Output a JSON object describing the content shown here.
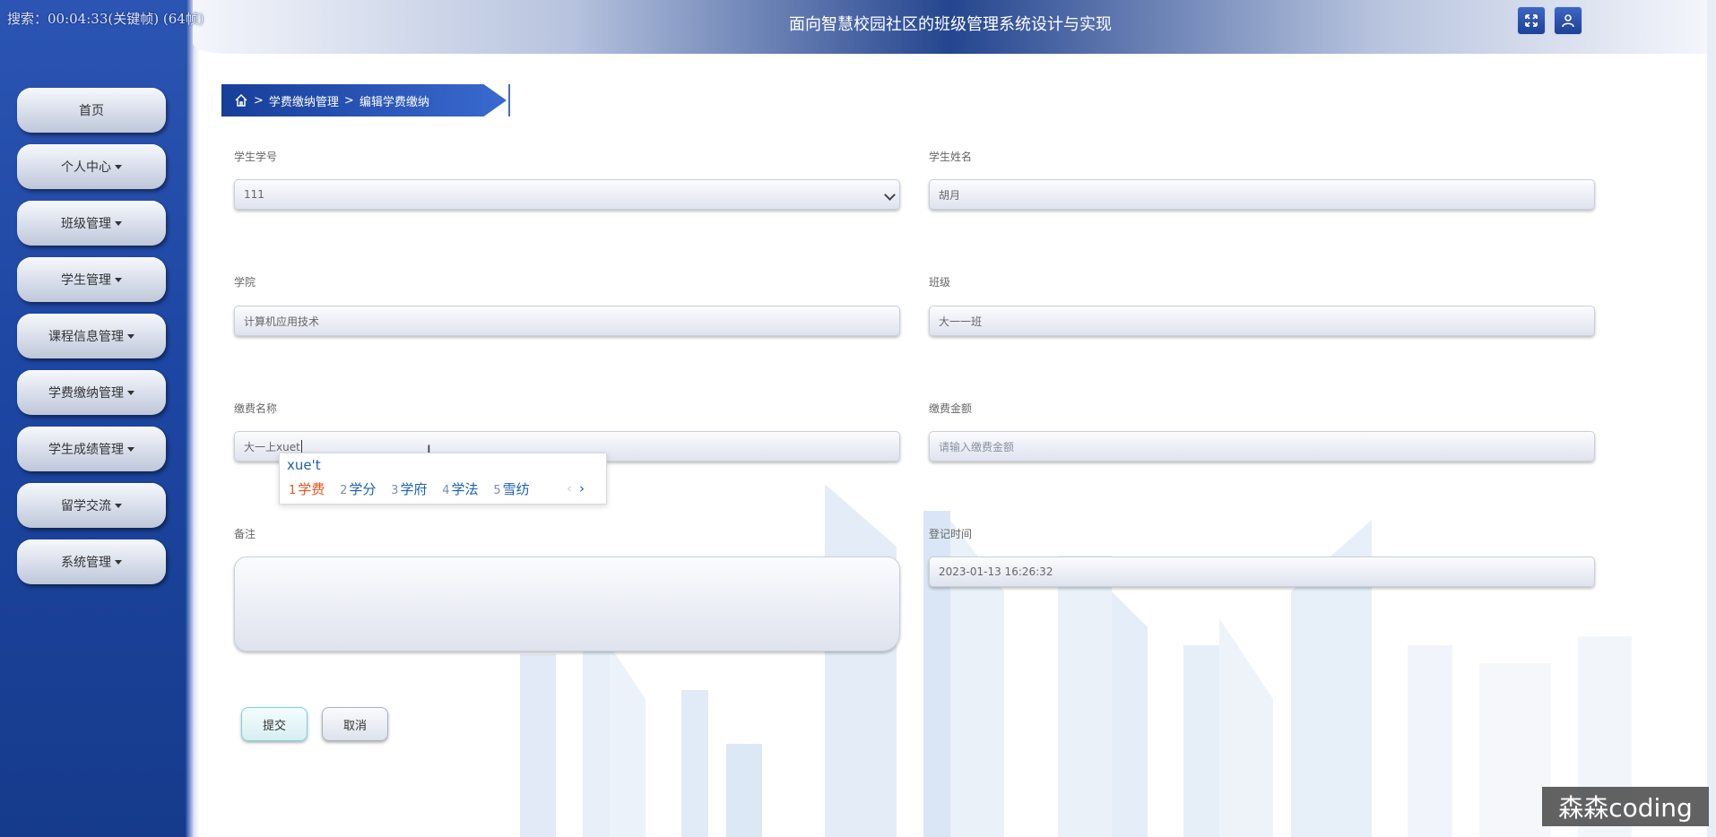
{
  "recorder_overlay": "搜索：00:04:33(关键帧) (64帧)",
  "header": {
    "title": "面向智慧校园社区的班级管理系统设计与实现"
  },
  "sidebar": {
    "items": [
      {
        "label": "首页"
      },
      {
        "label": "个人中心"
      },
      {
        "label": "班级管理"
      },
      {
        "label": "学生管理"
      },
      {
        "label": "课程信息管理"
      },
      {
        "label": "学费缴纳管理"
      },
      {
        "label": "学生成绩管理"
      },
      {
        "label": "留学交流"
      },
      {
        "label": "系统管理"
      }
    ]
  },
  "breadcrumb": {
    "sep": ">",
    "level1": "学费缴纳管理",
    "level2": "编辑学费缴纳"
  },
  "form": {
    "student_id": {
      "label": "学生学号",
      "value": "111"
    },
    "student_name": {
      "label": "学生姓名",
      "value": "胡月"
    },
    "college": {
      "label": "学院",
      "value": "计算机应用技术"
    },
    "class": {
      "label": "班级",
      "value": "大一一班"
    },
    "fee_name": {
      "label": "缴费名称",
      "value": "大一上xuet"
    },
    "fee_amount": {
      "label": "缴费金额",
      "placeholder": "请输入缴费金额"
    },
    "remark": {
      "label": "备注",
      "value": ""
    },
    "register_time": {
      "label": "登记时间",
      "value": "2023-01-13 16:26:32"
    },
    "submit_label": "提交",
    "cancel_label": "取消"
  },
  "ime": {
    "composition": "xue't",
    "candidates": [
      {
        "num": "1",
        "text": "学费"
      },
      {
        "num": "2",
        "text": "学分"
      },
      {
        "num": "3",
        "text": "学府"
      },
      {
        "num": "4",
        "text": "学法"
      },
      {
        "num": "5",
        "text": "雪纺"
      }
    ]
  },
  "watermark": "森森coding",
  "icons": {
    "fullscreen": "fullscreen-icon",
    "user": "user-icon",
    "home": "home-icon"
  }
}
